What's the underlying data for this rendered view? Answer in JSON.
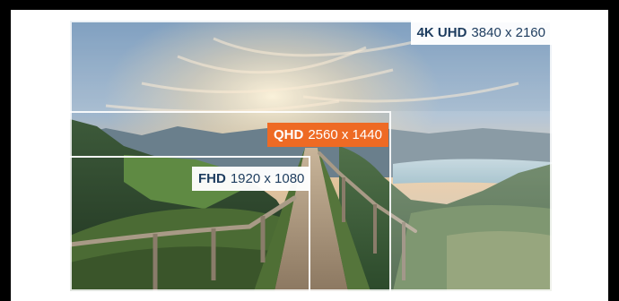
{
  "badges": {
    "uhd": {
      "name": "4K UHD",
      "resolution": "3840 x 2160"
    },
    "qhd": {
      "name": "QHD",
      "resolution": "2560 x 1440"
    },
    "fhd": {
      "name": "FHD",
      "resolution": "1920 x 1080"
    }
  },
  "colors": {
    "qhd_badge": "#ee6a24",
    "label_text": "#1d3c5e",
    "badge_background": "#ffffff"
  },
  "scene": {
    "description_icon": "landscape-path-photo"
  }
}
